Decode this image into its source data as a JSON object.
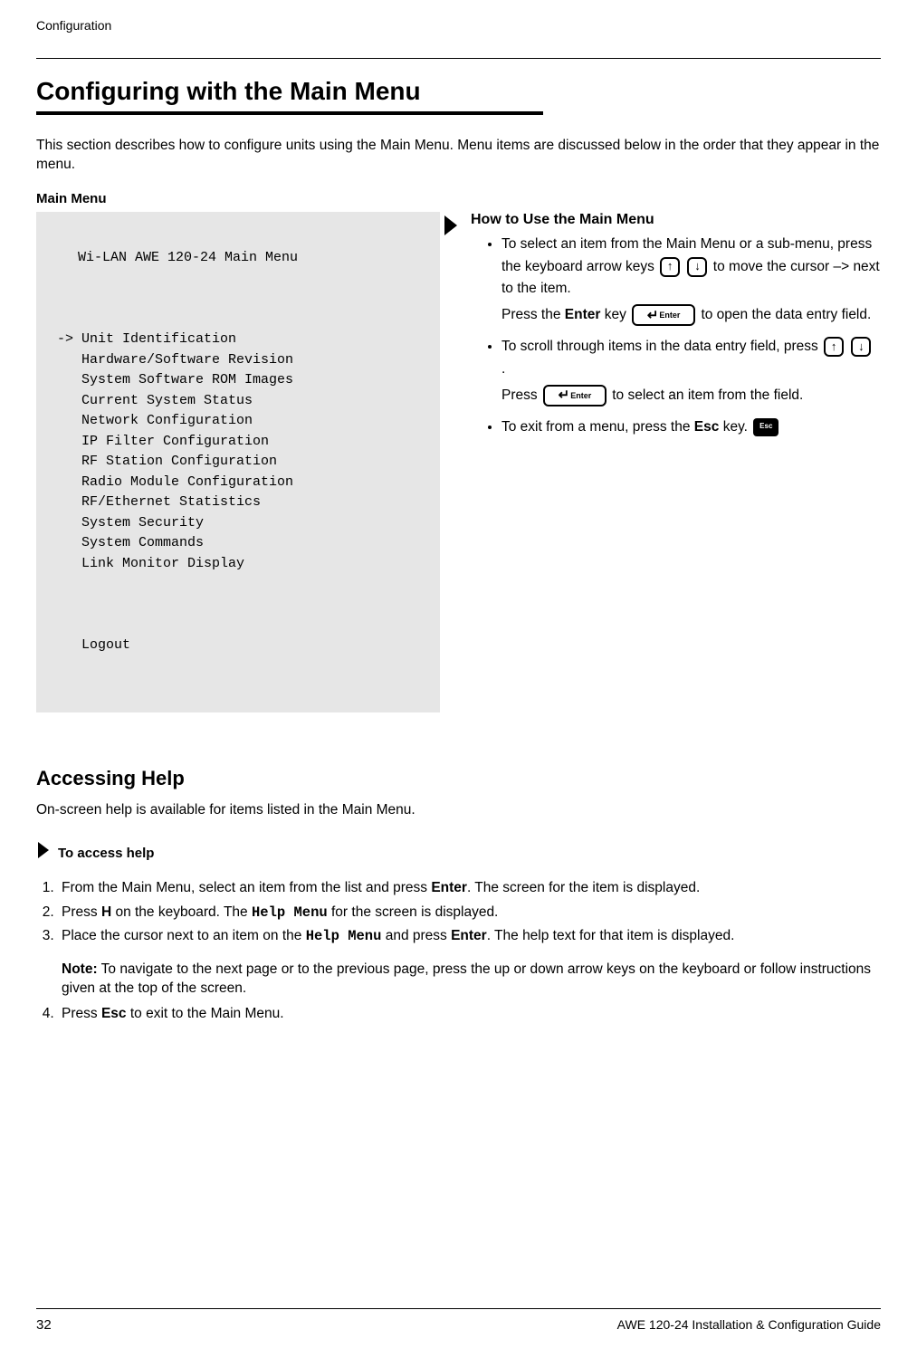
{
  "running_header": "Configuration",
  "section_title": "Configuring with the Main Menu",
  "intro_para": "This section describes how to configure units using the Main Menu. Menu items are discussed below in the order that they appear in the menu.",
  "menu_label": "Main Menu",
  "menu": {
    "title": "Wi-LAN AWE 120-24 Main Menu",
    "cursor": "->",
    "items": [
      "Unit Identification",
      "Hardware/Software Revision",
      "System Software ROM Images",
      "Current System Status",
      "Network Configuration",
      "IP Filter Configuration",
      "RF Station Configuration",
      "Radio Module Configuration",
      "RF/Ethernet Statistics",
      "System Security",
      "System Commands",
      "Link Monitor Display"
    ],
    "logout": "Logout"
  },
  "howto": {
    "title": "How to Use the Main Menu",
    "b1_a": "To select an item from the Main Menu or a sub-menu, press the keyboard arrow keys ",
    "b1_b": " to move the cursor –> next to the item.",
    "b1_c1": "Press the ",
    "enter_word": "Enter",
    "b1_c2": " key ",
    "b1_c3": " to open the data entry field.",
    "b2_a": "To scroll through items in the data entry field, press  ",
    "b2_b": " .",
    "b2_c1": "Press ",
    "b2_c2": " to select an item from the field.",
    "b3_a": "To exit from a menu, press the ",
    "esc_word": "Esc",
    "b3_b": " key. "
  },
  "help_section_title": "Accessing Help",
  "help_intro": "On-screen help is available for items listed in the Main Menu.",
  "proc_title": "To access help",
  "steps": {
    "s1_a": "From the Main Menu, select an item from the list and press ",
    "s1_enter": "Enter",
    "s1_b": ". The screen for the item is displayed.",
    "s2_a": "Press ",
    "s2_key": "H",
    "s2_b": " on the keyboard. The ",
    "s2_menu": "Help Menu",
    "s2_c": " for the screen is displayed.",
    "s3_a": "Place the cursor next to an item on the ",
    "s3_menu": "Help Menu",
    "s3_b": " and press ",
    "s3_enter": "Enter",
    "s3_c": ". The help text for that item is displayed.",
    "note_label": "Note:",
    "note_text": " To navigate to the next page or to the previous page, press the up or down arrow keys on the keyboard or follow instructions given at the top of the screen.",
    "s4_a": " Press ",
    "s4_esc": "Esc",
    "s4_b": " to exit to the Main Menu."
  },
  "key_labels": {
    "up": "↑",
    "down": "↓",
    "enter_icon": "Enter",
    "esc_icon": "Esc"
  },
  "footer": {
    "page_no": "32",
    "title": "AWE 120-24 Installation & Configuration Guide"
  }
}
